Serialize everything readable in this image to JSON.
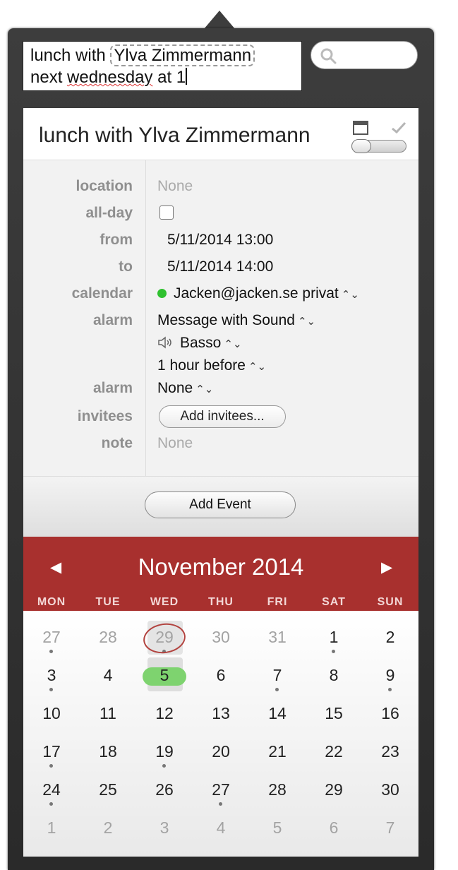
{
  "quick_entry": {
    "text_prefix": "lunch with ",
    "token": "Ylva Zimmermann",
    "line2_plain": "next ",
    "line2_misspelled": "wednesday",
    "line2_rest": " at 1"
  },
  "event": {
    "title": "lunch with Ylva Zimmermann",
    "fields": {
      "location_label": "location",
      "location_value": "None",
      "allday_label": "all-day",
      "from_label": "from",
      "from_value": "5/11/2014 13:00",
      "to_label": "to",
      "to_value": "5/11/2014 14:00",
      "calendar_label": "calendar",
      "calendar_value": "Jacken@jacken.se privat",
      "alarm_label": "alarm",
      "alarm_type": "Message with Sound",
      "alarm_sound": "Basso",
      "alarm_offset": "1  hour before",
      "alarm2_label": "alarm",
      "alarm2_value": "None",
      "invitees_label": "invitees",
      "invitees_button": "Add invitees...",
      "note_label": "note",
      "note_value": "None"
    },
    "add_button": "Add Event",
    "calendar_color": "#2fc12f"
  },
  "calendar": {
    "month_title": "November 2014",
    "prev_glyph": "◀",
    "next_glyph": "▶",
    "weekdays": [
      "MON",
      "TUE",
      "WED",
      "THU",
      "FRI",
      "SAT",
      "SUN"
    ],
    "accent": "#a8302e",
    "weeks": [
      [
        "27",
        "28",
        "29",
        "30",
        "31",
        "1",
        "2"
      ],
      [
        "3",
        "4",
        "5",
        "6",
        "7",
        "8",
        "9"
      ],
      [
        "10",
        "11",
        "12",
        "13",
        "14",
        "15",
        "16"
      ],
      [
        "17",
        "18",
        "19",
        "20",
        "21",
        "22",
        "23"
      ],
      [
        "24",
        "25",
        "26",
        "27",
        "28",
        "29",
        "30"
      ],
      [
        "1",
        "2",
        "3",
        "4",
        "5",
        "6",
        "7"
      ]
    ]
  },
  "icons": {
    "search": "search-icon",
    "window": "window-icon",
    "check": "checkmark-icon",
    "speaker": "speaker-icon"
  }
}
